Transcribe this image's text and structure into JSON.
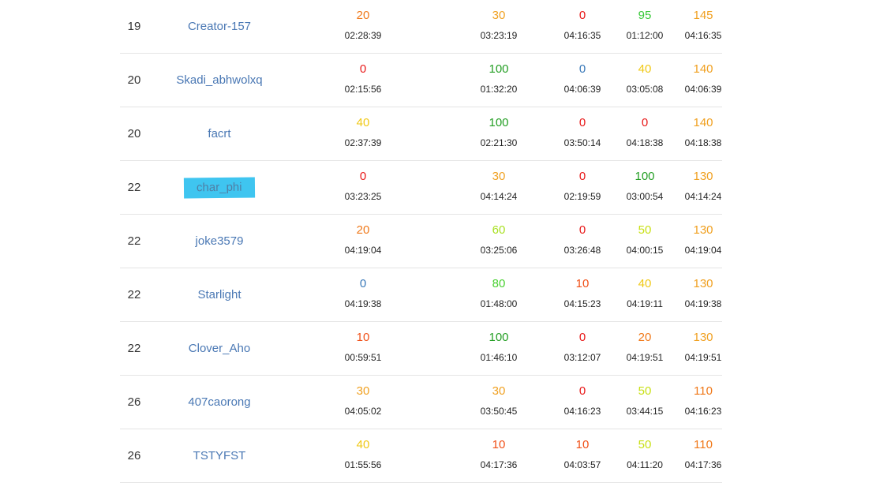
{
  "rows": [
    {
      "rank": "19",
      "user": "Creator-157",
      "highlighted": false,
      "cells": [
        {
          "score": "20",
          "time": "02:28:39",
          "color": "#f07818"
        },
        {
          "score": "30",
          "time": "03:23:19",
          "color": "#f0a020"
        },
        {
          "score": "0",
          "time": "04:16:35",
          "color": "#e81818"
        },
        {
          "score": "95",
          "time": "01:12:00",
          "color": "#38c838"
        },
        {
          "score": "145",
          "time": "04:16:35",
          "color": "#f0a020"
        }
      ]
    },
    {
      "rank": "20",
      "user": "Skadi_abhwolxq",
      "highlighted": false,
      "cells": [
        {
          "score": "0",
          "time": "02:15:56",
          "color": "#e81818"
        },
        {
          "score": "100",
          "time": "01:32:20",
          "color": "#239e23"
        },
        {
          "score": "0",
          "time": "04:06:39",
          "color": "#3878b8"
        },
        {
          "score": "40",
          "time": "03:05:08",
          "color": "#f0c814"
        },
        {
          "score": "140",
          "time": "04:06:39",
          "color": "#f0a020"
        }
      ]
    },
    {
      "rank": "20",
      "user": "facrt",
      "highlighted": false,
      "cells": [
        {
          "score": "40",
          "time": "02:37:39",
          "color": "#f0c814"
        },
        {
          "score": "100",
          "time": "02:21:30",
          "color": "#239e23"
        },
        {
          "score": "0",
          "time": "03:50:14",
          "color": "#e81818"
        },
        {
          "score": "0",
          "time": "04:18:38",
          "color": "#e81818"
        },
        {
          "score": "140",
          "time": "04:18:38",
          "color": "#f0a020"
        }
      ]
    },
    {
      "rank": "22",
      "user": "char_phi",
      "highlighted": true,
      "cells": [
        {
          "score": "0",
          "time": "03:23:25",
          "color": "#e81818"
        },
        {
          "score": "30",
          "time": "04:14:24",
          "color": "#f0a020"
        },
        {
          "score": "0",
          "time": "02:19:59",
          "color": "#e81818"
        },
        {
          "score": "100",
          "time": "03:00:54",
          "color": "#239e23"
        },
        {
          "score": "130",
          "time": "04:14:24",
          "color": "#f0a020"
        }
      ]
    },
    {
      "rank": "22",
      "user": "joke3579",
      "highlighted": false,
      "cells": [
        {
          "score": "20",
          "time": "04:19:04",
          "color": "#f07818"
        },
        {
          "score": "60",
          "time": "03:25:06",
          "color": "#a8e020"
        },
        {
          "score": "0",
          "time": "03:26:48",
          "color": "#e81818"
        },
        {
          "score": "50",
          "time": "04:00:15",
          "color": "#c8e014"
        },
        {
          "score": "130",
          "time": "04:19:04",
          "color": "#f0a020"
        }
      ]
    },
    {
      "rank": "22",
      "user": "Starlight",
      "highlighted": false,
      "cells": [
        {
          "score": "0",
          "time": "04:19:38",
          "color": "#3878b8"
        },
        {
          "score": "80",
          "time": "01:48:00",
          "color": "#48d030"
        },
        {
          "score": "10",
          "time": "04:15:23",
          "color": "#f05018"
        },
        {
          "score": "40",
          "time": "04:19:11",
          "color": "#f0c814"
        },
        {
          "score": "130",
          "time": "04:19:38",
          "color": "#f0a020"
        }
      ]
    },
    {
      "rank": "22",
      "user": "Clover_Aho",
      "highlighted": false,
      "cells": [
        {
          "score": "10",
          "time": "00:59:51",
          "color": "#f05018"
        },
        {
          "score": "100",
          "time": "01:46:10",
          "color": "#239e23"
        },
        {
          "score": "0",
          "time": "03:12:07",
          "color": "#e81818"
        },
        {
          "score": "20",
          "time": "04:19:51",
          "color": "#f07818"
        },
        {
          "score": "130",
          "time": "04:19:51",
          "color": "#f0a020"
        }
      ]
    },
    {
      "rank": "26",
      "user": "407caorong",
      "highlighted": false,
      "cells": [
        {
          "score": "30",
          "time": "04:05:02",
          "color": "#f0a020"
        },
        {
          "score": "30",
          "time": "03:50:45",
          "color": "#f0a020"
        },
        {
          "score": "0",
          "time": "04:16:23",
          "color": "#e81818"
        },
        {
          "score": "50",
          "time": "03:44:15",
          "color": "#c8e014"
        },
        {
          "score": "110",
          "time": "04:16:23",
          "color": "#f07818"
        }
      ]
    },
    {
      "rank": "26",
      "user": "TSTYFST",
      "highlighted": false,
      "cells": [
        {
          "score": "40",
          "time": "01:55:56",
          "color": "#f0c814"
        },
        {
          "score": "10",
          "time": "04:17:36",
          "color": "#f05018"
        },
        {
          "score": "10",
          "time": "04:03:57",
          "color": "#f05018"
        },
        {
          "score": "50",
          "time": "04:11:20",
          "color": "#c8e014"
        },
        {
          "score": "110",
          "time": "04:17:36",
          "color": "#f07818"
        }
      ]
    }
  ]
}
